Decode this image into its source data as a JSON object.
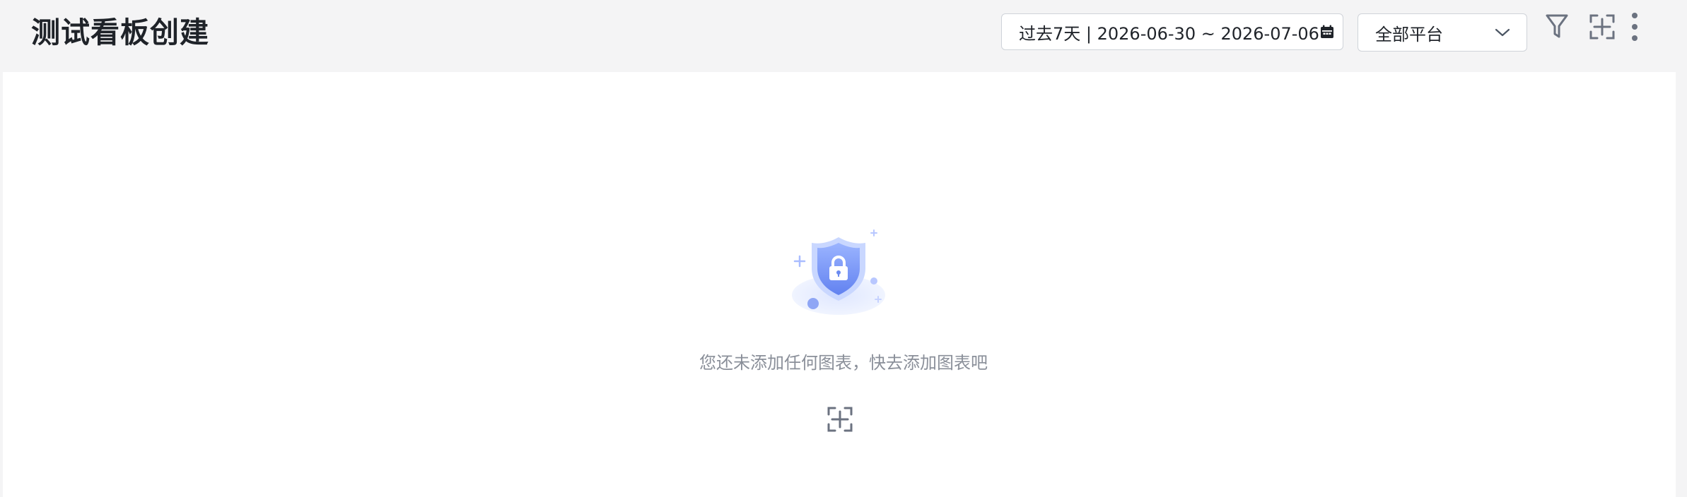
{
  "header": {
    "title": "测试看板创建",
    "date_range": "过去7天 | 2026-06-30 ~ 2026-07-06",
    "platform_select": "全部平台"
  },
  "icons": {
    "calendar": "calendar-icon",
    "chevron": "chevron-down-icon",
    "filter": "filter-icon",
    "add_chart": "add-chart-icon",
    "more": "more-vertical-icon",
    "illustration": "shield-lock-illustration"
  },
  "empty_state": {
    "message": "您还未添加任何图表，快去添加图表吧"
  },
  "colors": {
    "header_bg": "#f4f4f5",
    "content_bg": "#ffffff",
    "icon_gray": "#6b7280",
    "text_muted": "#8a8f99",
    "shield_blue": "#6f8ff5"
  }
}
